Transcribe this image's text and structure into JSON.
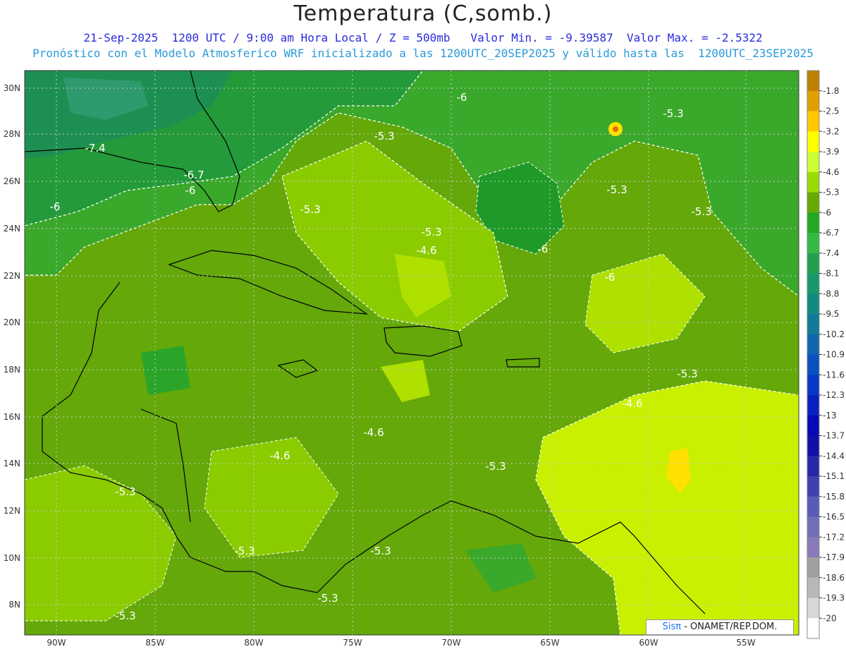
{
  "header": {
    "title": "Temperatura (C,somb.)",
    "line1": "21-Sep-2025  1200 UTC / 9:00 am Hora Local / Z = 500mb   Valor Min. = -9.39587  Valor Max. = -2.5322",
    "line2": "Pronóstico con el Modelo Atmosferico WRF inicializado a las 1200UTC_20SEP2025 y válido hasta las  1200UTC_23SEP2025"
  },
  "credit": {
    "brand": "Sisπ",
    "text": " - ONAMET/REP.DOM."
  },
  "map": {
    "lat_ticks": [
      "30N",
      "28N",
      "26N",
      "24N",
      "22N",
      "20N",
      "18N",
      "16N",
      "14N",
      "12N",
      "10N",
      "8N"
    ],
    "lon_ticks": [
      "90W",
      "85W",
      "80W",
      "75W",
      "70W",
      "65W",
      "60W",
      "55W"
    ],
    "contour_labels": [
      "-6",
      "-7.4",
      "-6.7",
      "-6",
      "-6",
      "-5.3",
      "-5.3",
      "-5.3",
      "-4.6",
      "-6",
      "-5.3",
      "-6",
      "-5.3",
      "-4.6",
      "-4.6",
      "-4.6",
      "-5.3",
      "-5.3",
      "-5.3",
      "-5.3",
      "-5.3",
      "-5.3",
      "-5.3",
      "-5.3"
    ],
    "colors": {
      "dark_teal": "#2e9a6e",
      "green_dark": "#1f9a28",
      "green": "#3aa82a",
      "green_mid": "#64a80a",
      "yellow_green": "#8bcc00",
      "light_green": "#aee000",
      "lime": "#c8f000",
      "yellow": "#ffe000"
    }
  },
  "colorbar": {
    "labels": [
      "-1.8",
      "-2.5",
      "-3.2",
      "-3.9",
      "-4.6",
      "-5.3",
      "-6",
      "-6.7",
      "-7.4",
      "-8.1",
      "-8.8",
      "-9.5",
      "-10.2",
      "-10.9",
      "-11.6",
      "-12.3",
      "-13",
      "-13.7",
      "-14.4",
      "-15.1",
      "-15.8",
      "-16.5",
      "-17.2",
      "-17.9",
      "-18.6",
      "-19.3",
      "-20"
    ],
    "colors": [
      "#c08000",
      "#e0a000",
      "#ffc800",
      "#ffff00",
      "#ccff33",
      "#99dd00",
      "#66aa00",
      "#22aa22",
      "#33bb44",
      "#22a050",
      "#169a6a",
      "#128a80",
      "#107a98",
      "#0f66b0",
      "#0a50c0",
      "#0838c8",
      "#0a20c0",
      "#0808b8",
      "#1010a8",
      "#2828a8",
      "#4040b0",
      "#5a5ab8",
      "#7070b8",
      "#8a7ab8",
      "#a0a0a0",
      "#b8b8b8",
      "#d8d8d8",
      "#ffffff"
    ]
  }
}
